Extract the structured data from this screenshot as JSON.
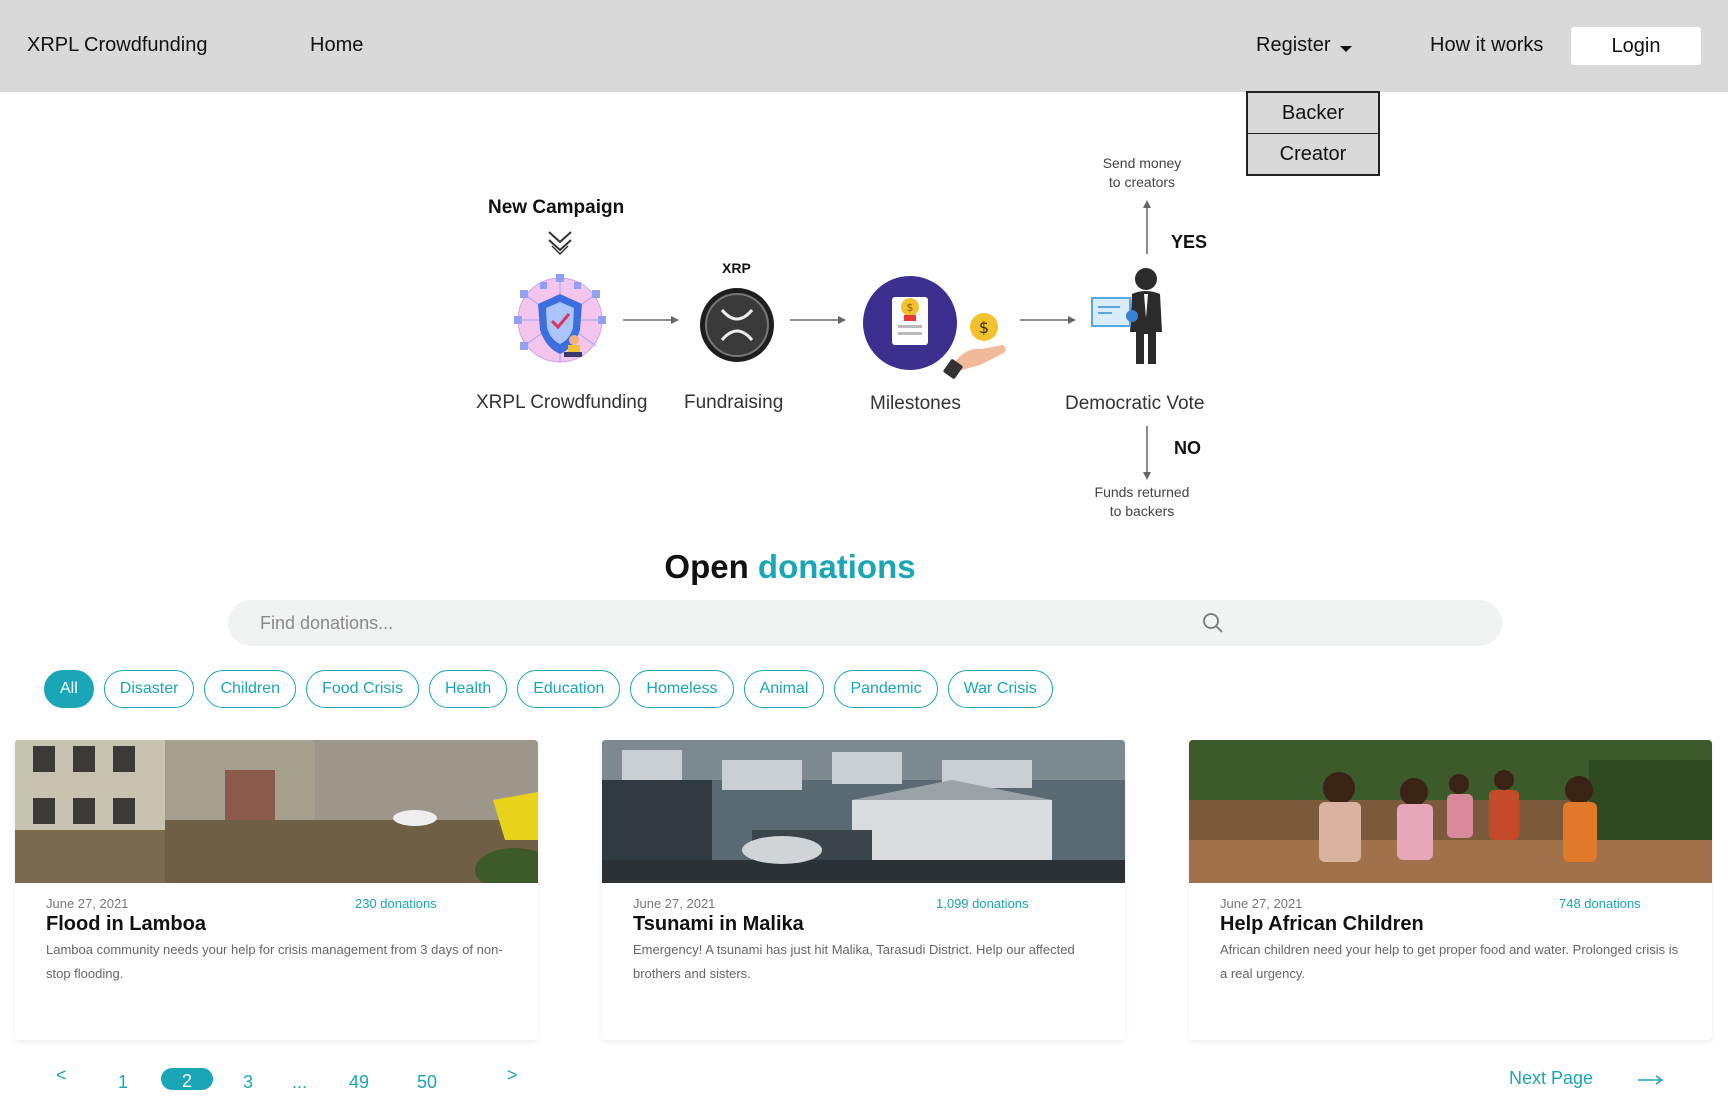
{
  "nav": {
    "brand": "XRPL Crowdfunding",
    "home": "Home",
    "register": "Register",
    "how_it_works": "How it works",
    "login": "Login",
    "register_menu": [
      "Backer",
      "Creator"
    ]
  },
  "diagram": {
    "new_campaign": "New Campaign",
    "xrp_tag": "XRP",
    "steps": [
      "XRPL Crowdfunding",
      "Fundraising",
      "Milestones",
      "Democratic Vote"
    ],
    "yes": "YES",
    "no": "NO",
    "yes_note_1": "Send money",
    "yes_note_2": "to creators",
    "no_note_1": "Funds returned",
    "no_note_2": "to backers"
  },
  "donations": {
    "title_main": "Open",
    "title_accent": "donations",
    "search_placeholder": "Find donations...",
    "filters": [
      "All",
      "Disaster",
      "Children",
      "Food Crisis",
      "Health",
      "Education",
      "Homeless",
      "Animal",
      "Pandemic",
      "War Crisis"
    ],
    "active_filter": "All",
    "cards": [
      {
        "date": "June 27, 2021",
        "count": "230 donations",
        "title": "Flood in Lamboa",
        "desc": "Lamboa community needs your help for crisis management from 3 days of non-stop flooding."
      },
      {
        "date": "June 27, 2021",
        "count": "1,099 donations",
        "title": "Tsunami in Malika",
        "desc": "Emergency! A tsunami has just hit Malika, Tarasudi District. Help our affected brothers and sisters."
      },
      {
        "date": "June 27, 2021",
        "count": "748 donations",
        "title": "Help African Children",
        "desc": "African children need your help to get proper food and water. Prolonged crisis is a real urgency."
      }
    ]
  },
  "pagination": {
    "prev": "<",
    "pages": [
      "1",
      "2",
      "3",
      "...",
      "49",
      "50"
    ],
    "current": "2",
    "next": ">",
    "next_page": "Next Page"
  },
  "colors": {
    "accent": "#1aa6b7",
    "nav_bg": "#d9d9d9"
  }
}
